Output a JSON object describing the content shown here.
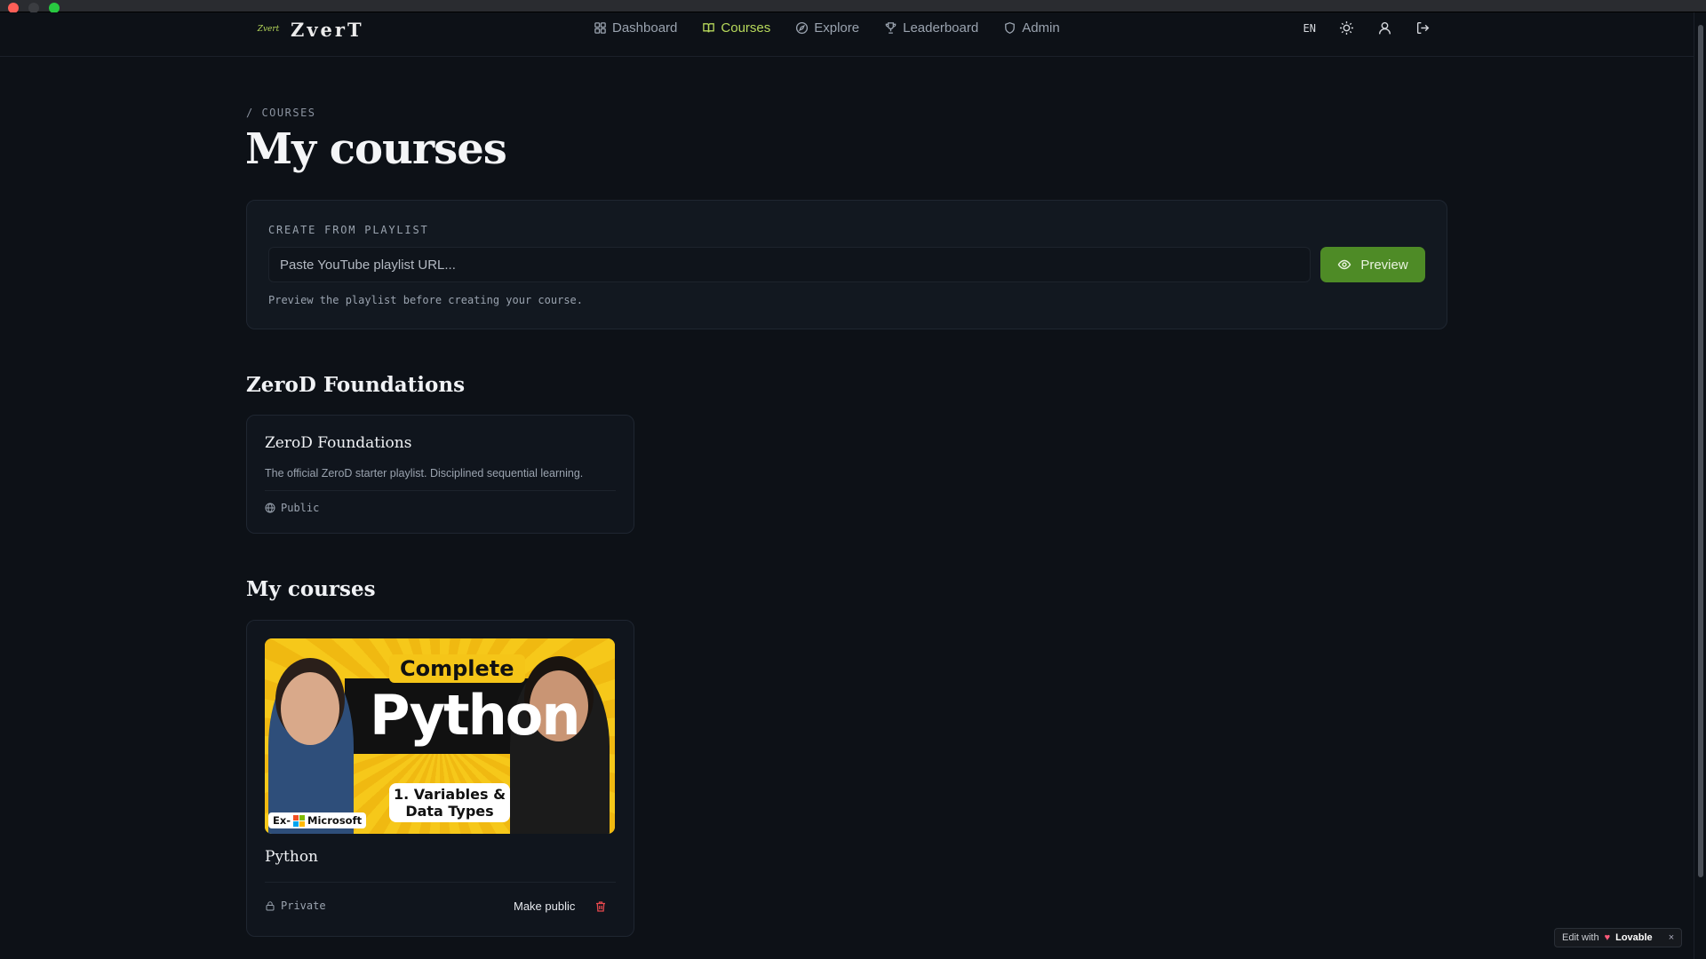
{
  "app": {
    "name": "ZverT",
    "logo_mark": "Zvert"
  },
  "nav": {
    "items": [
      {
        "label": "Dashboard",
        "icon": "grid-icon",
        "active": false
      },
      {
        "label": "Courses",
        "icon": "book-icon",
        "active": true
      },
      {
        "label": "Explore",
        "icon": "compass-icon",
        "active": false
      },
      {
        "label": "Leaderboard",
        "icon": "trophy-icon",
        "active": false
      },
      {
        "label": "Admin",
        "icon": "shield-icon",
        "active": false
      }
    ],
    "language": "EN",
    "right_icons": [
      "sun-icon",
      "user-icon",
      "logout-icon"
    ]
  },
  "page": {
    "breadcrumb": "/ COURSES",
    "title": "My courses"
  },
  "create": {
    "label": "CREATE FROM PLAYLIST",
    "input_placeholder": "Paste YouTube playlist URL...",
    "input_value": "",
    "button_label": "Preview",
    "hint": "Preview the playlist before creating your course."
  },
  "foundations": {
    "section_title": "ZeroD Foundations",
    "card": {
      "title": "ZeroD Foundations",
      "description": "The official ZeroD starter playlist. Disciplined sequential learning.",
      "visibility": "Public"
    }
  },
  "my_courses": {
    "section_title": "My courses",
    "card": {
      "thumbnail": {
        "top_text": "Complete",
        "main_text": "Python",
        "sub_text_line1": "1. Variables &",
        "sub_text_line2": "Data Types",
        "badge_prefix": "Ex-",
        "badge_text": "Microsoft"
      },
      "title": "Python",
      "visibility": "Private",
      "action_label": "Make public"
    }
  },
  "lovable": {
    "prefix": "Edit with",
    "brand": "Lovable",
    "close": "×"
  },
  "colors": {
    "accent": "#b7d95b",
    "primary_button": "#4e8b26",
    "background": "#0d1117",
    "danger": "#e5484d"
  }
}
